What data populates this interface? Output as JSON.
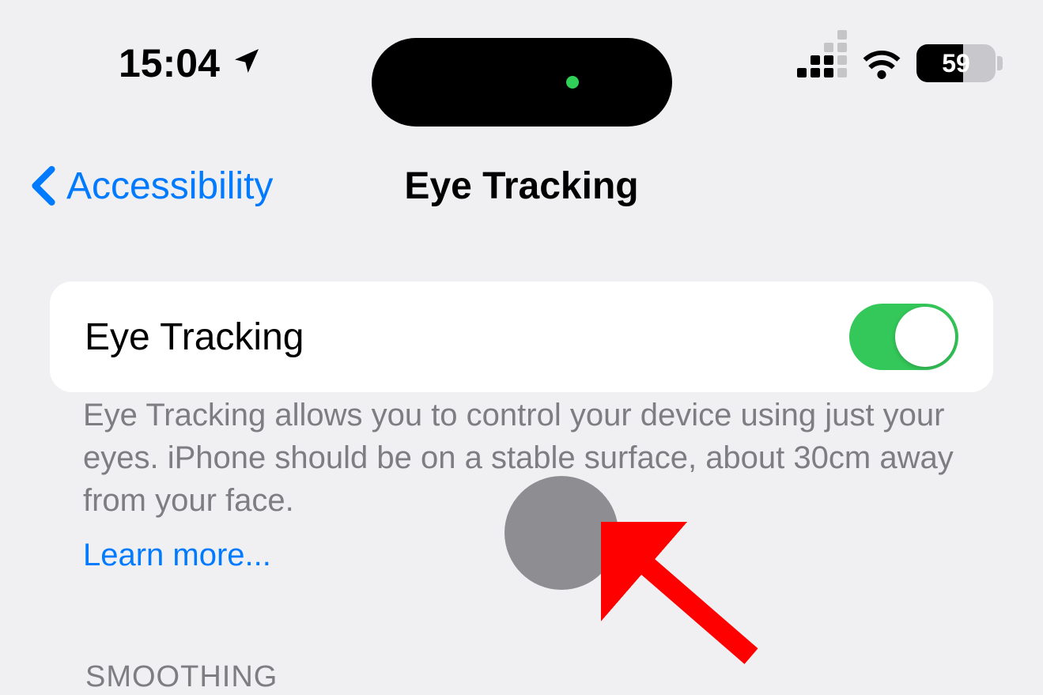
{
  "statusBar": {
    "time": "15:04",
    "batteryPercent": "59",
    "batteryFill": 59
  },
  "nav": {
    "backLabel": "Accessibility",
    "title": "Eye Tracking"
  },
  "settings": {
    "eyeTracking": {
      "label": "Eye Tracking",
      "enabled": true,
      "description": "Eye Tracking allows you to control your device using just your eyes. iPhone should be on a stable surface, about 30cm away from your face.",
      "learnMore": "Learn more..."
    }
  },
  "sections": {
    "smoothing": "SMOOTHING"
  }
}
